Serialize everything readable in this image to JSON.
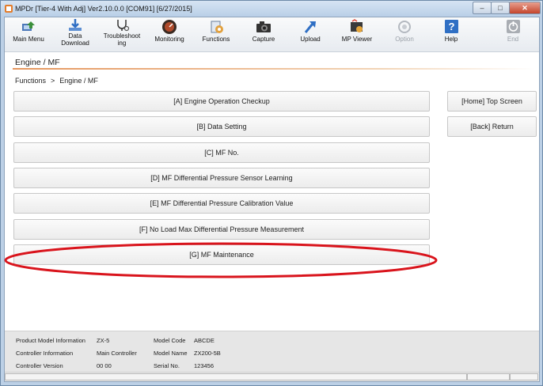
{
  "window": {
    "title": "MPDr [Tier-4 With Adj] Ver2.10.0.0 [COM91] [6/27/2015]",
    "controls": {
      "minimize": "–",
      "maximize": "□",
      "close": "✕"
    }
  },
  "toolbar": {
    "items": [
      {
        "label": "Main Menu",
        "icon": "main-menu-icon",
        "enabled": true
      },
      {
        "label": "Data\nDownload",
        "icon": "download-icon",
        "enabled": true
      },
      {
        "label": "Troubleshoot\ning",
        "icon": "stethoscope-icon",
        "enabled": true
      },
      {
        "label": "Monitoring",
        "icon": "gauge-icon",
        "enabled": true
      },
      {
        "label": "Functions",
        "icon": "functions-icon",
        "enabled": true
      },
      {
        "label": "Capture",
        "icon": "camera-icon",
        "enabled": true
      },
      {
        "label": "Upload",
        "icon": "upload-icon",
        "enabled": true
      },
      {
        "label": "MP Viewer",
        "icon": "viewer-icon",
        "enabled": true
      },
      {
        "label": "Option",
        "icon": "option-icon",
        "enabled": false
      },
      {
        "label": "Help",
        "icon": "help-icon",
        "enabled": true
      },
      {
        "label": "End",
        "icon": "power-icon",
        "enabled": false
      }
    ]
  },
  "page": {
    "title": "Engine / MF",
    "breadcrumb": {
      "root": "Functions",
      "separator": ">",
      "current": "Engine / MF"
    }
  },
  "menu": {
    "buttons": [
      "[A] Engine Operation Checkup",
      "[B] Data Setting",
      "[C] MF No.",
      "[D] MF Differential Pressure Sensor Learning",
      "[E] MF Differential Pressure Calibration Value",
      "[F] No Load Max Differential Pressure Measurement",
      "[G] MF Maintenance"
    ],
    "side": {
      "home": "[Home] Top Screen",
      "back": "[Back] Return"
    }
  },
  "info": {
    "product_model_label": "Product Model Information",
    "product_model_value": "ZX-5",
    "controller_info_label": "Controller Information",
    "controller_info_value": "Main Controller",
    "controller_version_label": "Controller Version",
    "controller_version_value": "00 00",
    "model_code_label": "Model Code",
    "model_code_value": "ABCDE",
    "model_name_label": "Model Name",
    "model_name_value": "ZX200-5B",
    "serial_label": "Serial No.",
    "serial_value": "123456"
  },
  "colors": {
    "highlight_ellipse": "#d9141c",
    "title_underline": "#e5965d",
    "help_blue": "#2f6fc4"
  }
}
